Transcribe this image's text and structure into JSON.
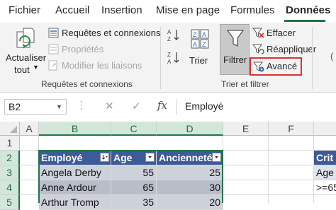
{
  "menu": {
    "tabs": [
      "Fichier",
      "Accueil",
      "Insertion",
      "Mise en page",
      "Formules",
      "Données"
    ],
    "active_tab": "Données"
  },
  "ribbon": {
    "group1": {
      "refresh_line1": "Actualiser",
      "refresh_line2": "tout",
      "queries": "Requêtes et connexions",
      "properties": "Propriétés",
      "edit_links": "Modifier les liaisons",
      "label": "Requêtes et connexions"
    },
    "group2": {
      "sort": "Trier",
      "filter": "Filtrer",
      "clear": "Effacer",
      "reapply": "Réappliquer",
      "advanced": "Avancé",
      "label": "Trier et filtrer"
    }
  },
  "formula_bar": {
    "name_box": "B2",
    "fx": "fx",
    "value": "Employé"
  },
  "grid": {
    "columns": [
      "A",
      "B",
      "C",
      "D",
      "E",
      "F"
    ],
    "rows": [
      "1",
      "2",
      "3",
      "4",
      "5"
    ],
    "table_headers": [
      "Employé",
      "Age",
      "Ancienneté"
    ],
    "table_rows": [
      [
        "Angela Derby",
        "55",
        "25"
      ],
      [
        "Anne Ardour",
        "65",
        "30"
      ],
      [
        "Arthur Tromp",
        "35",
        "20"
      ]
    ],
    "criteria": {
      "title": "Crit",
      "header": "Age",
      "value": ">=65"
    }
  },
  "colors": {
    "excel_green": "#217346",
    "table_header": "#3d5a99",
    "table_body": "#cdd1da",
    "highlight_box": "#e03030"
  }
}
